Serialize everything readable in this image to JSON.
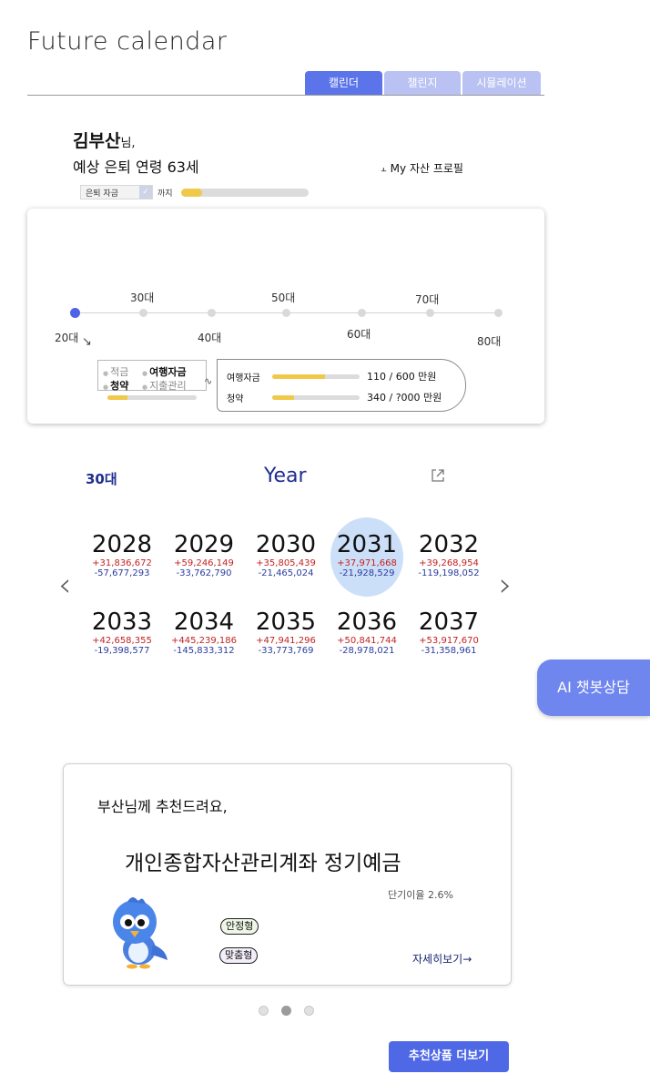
{
  "app_title": "Future calendar",
  "tabs": [
    {
      "label": "캘린더",
      "active": true
    },
    {
      "label": "챌린지",
      "active": false
    },
    {
      "label": "시뮬레이션",
      "active": false
    }
  ],
  "greeting": {
    "name": "김부산",
    "name_suffix": "님,",
    "retire_age_text": "예상 은퇴 연령 63세",
    "profile_link": "My 자산 프로필",
    "profile_icon": "tree-icon"
  },
  "goal": {
    "select_value": "은퇴 자금",
    "suffix": "까지",
    "progress": 0.17
  },
  "timeline": {
    "current": "20대",
    "decades": [
      "20대",
      "30대",
      "40대",
      "50대",
      "60대",
      "70대",
      "80대"
    ],
    "savings": {
      "items": [
        "적금",
        "여행자금",
        "청약",
        "지출관리"
      ],
      "progress": 0.22
    },
    "goals": [
      {
        "label": "여행자금",
        "progress": 0.6,
        "value": "110 / 600 만원"
      },
      {
        "label": "청약",
        "progress": 0.25,
        "value": "340 / ?000 만원"
      }
    ]
  },
  "calendar": {
    "decade": "30대",
    "view": "Year",
    "selected_year": "2031",
    "years": [
      {
        "year": "2028",
        "income": "+31,836,672",
        "expense": "-57,677,293"
      },
      {
        "year": "2029",
        "income": "+59,246,149",
        "expense": "-33,762,790"
      },
      {
        "year": "2030",
        "income": "+35,805,439",
        "expense": "-21,465,024"
      },
      {
        "year": "2031",
        "income": "+37,971,668",
        "expense": "-21,928,529"
      },
      {
        "year": "2032",
        "income": "+39,268,954",
        "expense": "-119,198,052"
      },
      {
        "year": "2033",
        "income": "+42,658,355",
        "expense": "-19,398,577"
      },
      {
        "year": "2034",
        "income": "+445,239,186",
        "expense": "-145,833,312"
      },
      {
        "year": "2035",
        "income": "+47,941,296",
        "expense": "-33,773,769"
      },
      {
        "year": "2036",
        "income": "+50,841,744",
        "expense": "-28,978,021"
      },
      {
        "year": "2037",
        "income": "+53,917,670",
        "expense": "-31,358,961"
      }
    ]
  },
  "chatbot": {
    "label": "AI 챗봇상담"
  },
  "recommendation": {
    "greeting": "부산님께 추천드려요,",
    "product": "개인종합자산관리계좌 정기예금",
    "rate": "단기이율 2.6%",
    "tags": [
      "안정형",
      "맞춤형"
    ],
    "more_link": "자세히보기→",
    "page_count": 3,
    "active_page": 1
  },
  "more_button": "추천상품 더보기",
  "colors": {
    "accent": "#5c74ea",
    "tab_inactive": "#b9c2f2",
    "income": "#c42222",
    "expense": "#2a3c9e",
    "progress": "#f0c94a",
    "highlight": "#c6dcf7"
  }
}
